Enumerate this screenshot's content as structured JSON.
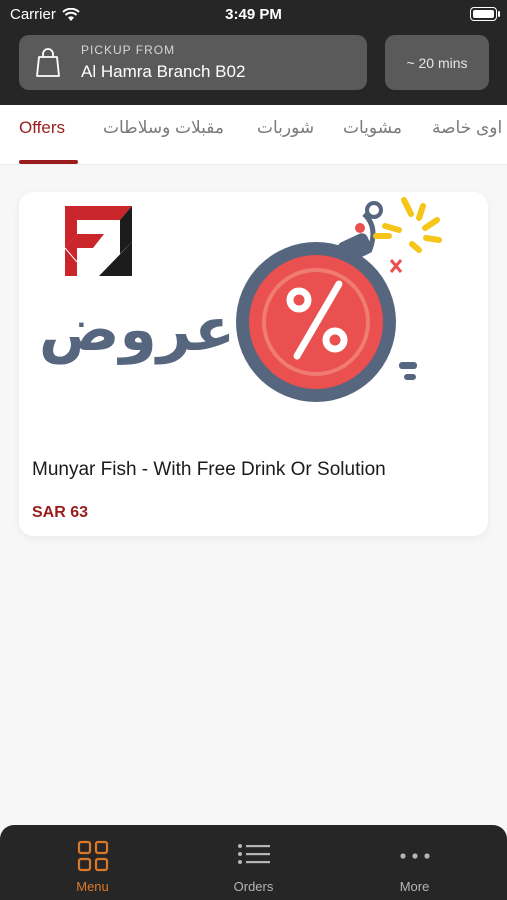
{
  "status_bar": {
    "carrier": "Carrier",
    "time": "3:49 PM"
  },
  "header": {
    "pickup_label": "PICKUP FROM",
    "branch": "Al Hamra Branch B02",
    "eta": "~ 20 mins"
  },
  "tabs": [
    {
      "label": "Offers",
      "active": true
    },
    {
      "label": "مقبلات وسلاطات"
    },
    {
      "label": "شوربات"
    },
    {
      "label": "مشويات"
    },
    {
      "label": "اوى خاصة"
    }
  ],
  "card": {
    "image_text": "عروض",
    "name": "Munyar Fish - With Free Drink Or Solution",
    "price": "SAR 63"
  },
  "bottom_nav": [
    {
      "label": "Menu",
      "icon": "grid-icon",
      "active": true
    },
    {
      "label": "Orders",
      "icon": "list-icon"
    },
    {
      "label": "More",
      "icon": "more-icon"
    }
  ],
  "colors": {
    "accent": "#9b1c1c",
    "nav_active": "#d87a2a",
    "header_bg": "#262626"
  }
}
